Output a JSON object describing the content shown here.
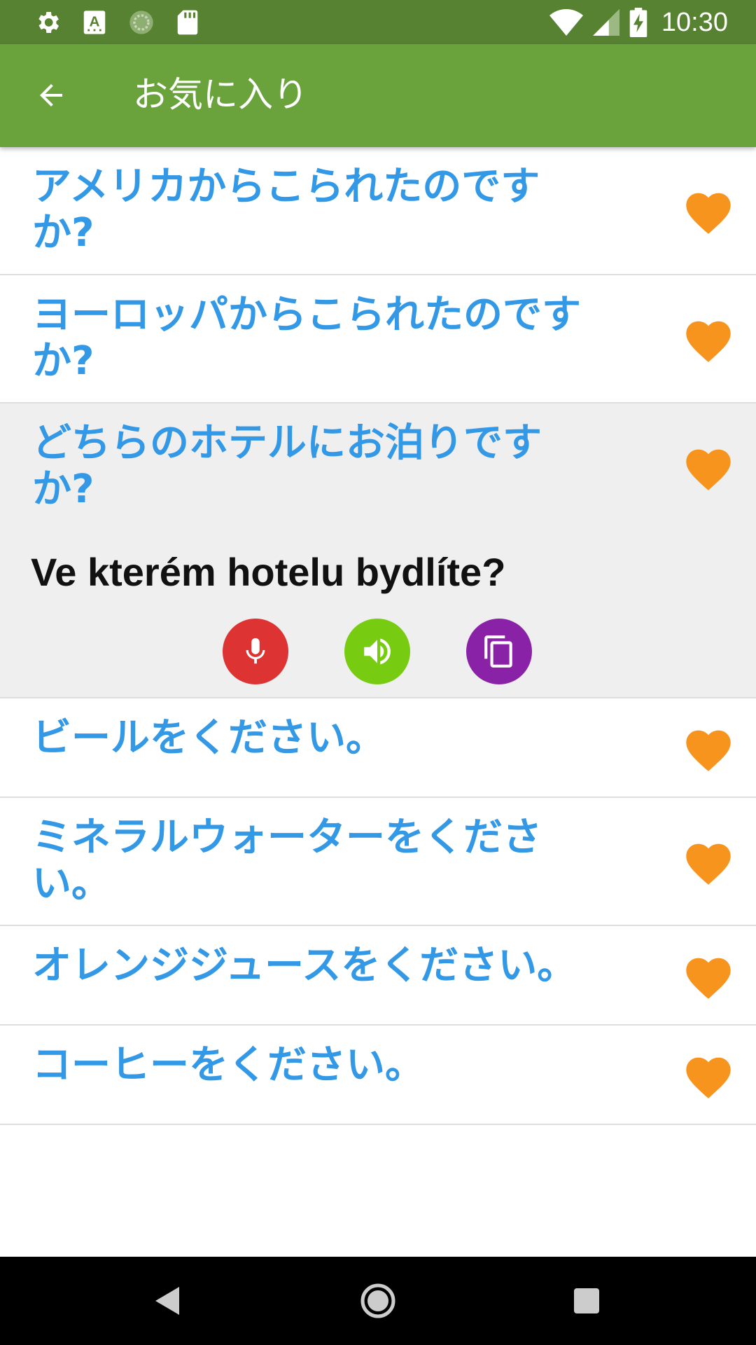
{
  "status_bar": {
    "time": "10:30",
    "left_icons": [
      "settings-icon",
      "accessibility-a-icon",
      "sync-circle-icon",
      "sd-card-icon"
    ],
    "right_icons": [
      "wifi-icon",
      "cellular-signal-icon",
      "battery-charging-icon"
    ]
  },
  "app_bar": {
    "title": "お気に入り",
    "back_icon": "arrow-left-icon"
  },
  "colors": {
    "status_bar": "#568231",
    "app_bar": "#6aa33b",
    "phrase_text": "#3399e6",
    "heart": "#f7941d",
    "mic_button": "#dd3333",
    "speaker_button": "#77cc11",
    "copy_button": "#8a22a8"
  },
  "phrases": [
    {
      "text": "アメリカからこられたのですか?",
      "favorite": true
    },
    {
      "text": "ヨーロッパからこられたのですか?",
      "favorite": true
    },
    {
      "text": "どちらのホテルにお泊りですか?",
      "favorite": true,
      "translation": "Ve kterém hotelu bydlíte?"
    },
    {
      "text": "ビールをください。",
      "favorite": true
    },
    {
      "text": "ミネラルウォーターをください。",
      "favorite": true
    },
    {
      "text": "オレンジジュースをください。",
      "favorite": true
    },
    {
      "text": "コーヒーをください。",
      "favorite": true
    }
  ],
  "action_icons": [
    "microphone-icon",
    "speaker-icon",
    "copy-icon"
  ],
  "nav_bar": [
    "back-triangle-icon",
    "home-circle-icon",
    "recents-square-icon"
  ]
}
